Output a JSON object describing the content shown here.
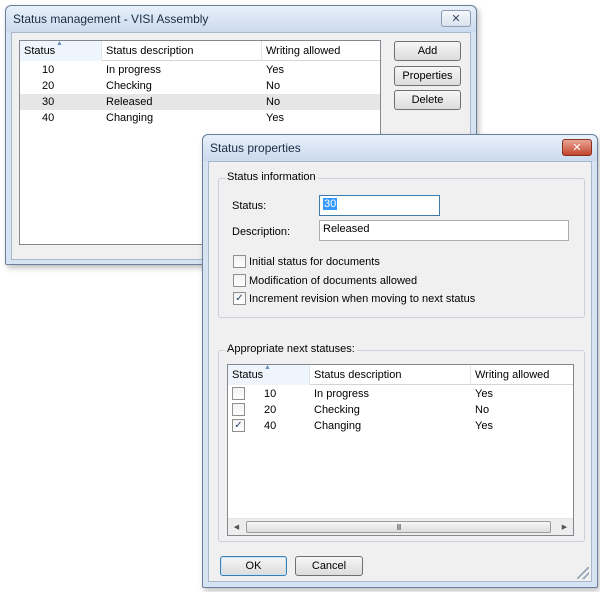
{
  "main_window": {
    "title": "Status management - VISI Assembly",
    "close_label": "✕",
    "columns": [
      "Status",
      "Status description",
      "Writing allowed"
    ],
    "rows": [
      {
        "status": "10",
        "description": "In progress",
        "writing": "Yes",
        "selected": false
      },
      {
        "status": "20",
        "description": "Checking",
        "writing": "No",
        "selected": false
      },
      {
        "status": "30",
        "description": "Released",
        "writing": "No",
        "selected": true
      },
      {
        "status": "40",
        "description": "Changing",
        "writing": "Yes",
        "selected": false
      }
    ],
    "buttons": {
      "add": "Add",
      "properties": "Properties",
      "delete": "Delete"
    }
  },
  "properties_dialog": {
    "title": "Status properties",
    "close_label": "✕",
    "status_info": {
      "caption": "Status information",
      "status_label": "Status:",
      "status_value": "30",
      "description_label": "Description:",
      "description_value": "Released"
    },
    "options": [
      {
        "label": "Initial status for documents",
        "checked": false
      },
      {
        "label": "Modification of documents allowed",
        "checked": false
      },
      {
        "label": "Increment revision when moving to next status",
        "checked": true
      }
    ],
    "next_statuses": {
      "caption": "Appropriate next statuses:",
      "columns": [
        "Status",
        "Status description",
        "Writing allowed"
      ],
      "rows": [
        {
          "status": "10",
          "description": "In progress",
          "writing": "Yes",
          "checked": false
        },
        {
          "status": "20",
          "description": "Checking",
          "writing": "No",
          "checked": false
        },
        {
          "status": "40",
          "description": "Changing",
          "writing": "Yes",
          "checked": true
        }
      ],
      "scroll_thumb_glyph": "III"
    },
    "buttons": {
      "ok": "OK",
      "cancel": "Cancel"
    }
  },
  "icons": {
    "sort_ascending": "sort-ascending-icon",
    "check_mark": "✓",
    "scroll_left": "◀",
    "scroll_right": "▶"
  },
  "colors": {
    "selection_row": "#e6e6e6",
    "close_red": "#c4452c",
    "text_highlight": "#3399ff"
  }
}
